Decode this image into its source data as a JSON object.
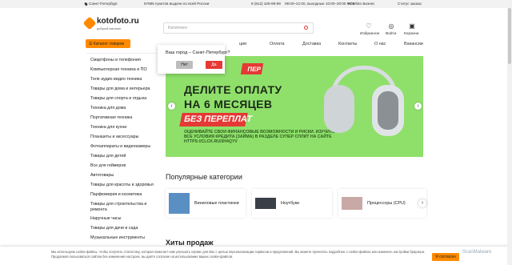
{
  "topbar": {
    "city": "Санкт-Петербург",
    "points": "57885 пунктов выдачи по всей России",
    "phone": "8 (812) 426-98-99",
    "hours": "09:00–21:00, выходные 10:00–20:00 МСК",
    "business": "Kotofoto Бизнес",
    "order_status": "Статус заказа"
  },
  "header": {
    "logo": "kotofoto.ru",
    "logo_sub": "добрый магазин",
    "search_placeholder": "Катипоен",
    "favorites": "Избранное",
    "login": "Войти",
    "cart": "Корзина"
  },
  "catalog_button": "Каталог товаров",
  "nav": [
    "ции",
    "Оплата",
    "Доставка",
    "Контакты",
    "О нас",
    "Вакансии"
  ],
  "sidebar": [
    "Смартфоны и телефония",
    "Компьютерная техника и ПО",
    "Теле аудио видео техника",
    "Товары для дома и интерьера",
    "Товары для спорта и отдыха",
    "Техника для дома",
    "Портативная техника",
    "Техника для кухни",
    "Планшеты и аксессуары",
    "Фотоаппараты и видеокамеры",
    "Товары для детей",
    "Все для геймеров",
    "Автотовары",
    "Товары для красоты и здоровья",
    "Парфюмерия и косметика",
    "Товары для строительства и ремонта",
    "Наручные часы",
    "Товары для дачи и сада",
    "Музыкальные инструменты"
  ],
  "popup": {
    "question": "Ваш город – Санкт-Петербург?",
    "no": "Нет",
    "yes": "Да"
  },
  "banner": {
    "tag": "ПЕР",
    "line1": "ДЕЛИТЕ ОПЛАТУ",
    "line2": "НА 6 МЕСЯЦЕВ",
    "line3": "БЕЗ ПЕРЕПЛАТ",
    "fine": "ОЦЕНИВАЙТЕ СВОИ ФИНАНСОВЫЕ ВОЗМОЖНОСТИ И РИСКИ. ИЗУЧИТЕ ВСЕ УСЛОВИЯ КРЕДИТА (ЗАЙМА) В РАЗДЕЛЕ СУПЕР СПЛИТ НА САЙТЕ HTTPS://CLCK.RU/3H4QYV"
  },
  "popular": {
    "title": "Популярные категории",
    "cards": [
      "Виниловые пластинки",
      "Ноутбуки",
      "Процессоры (CPU)"
    ]
  },
  "hits_title": "Хиты продаж",
  "cookie": {
    "text": "Мы используем cookie-файлы, чтобы получить статистику, которая помогает нам улучшить сервис для Вас с целью персонализации сервисов и предложений. Вы можете прочитать подробнее о cookie-файлах или изменить настройки браузера. Продолжая пользоваться сайтом без изменения настроек, вы даёте согласие на использование ваших cookie-файлов.",
    "button": "Я согласен"
  },
  "watermark": "ScanMalware"
}
